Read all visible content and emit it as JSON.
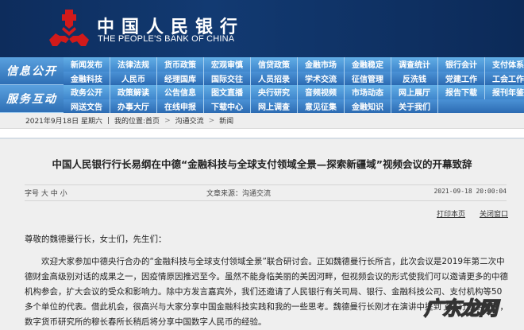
{
  "header": {
    "title_cn": "中国人民银行",
    "title_en": "THE PEOPLE'S BANK OF CHINA"
  },
  "nav": {
    "sections": [
      "信息公开",
      "服务互动"
    ],
    "rows": [
      [
        "新闻发布",
        "法律法规",
        "货币政策",
        "宏观审慎",
        "信贷政策",
        "金融市场",
        "金融稳定",
        "调查统计",
        "银行会计",
        "支付体系"
      ],
      [
        "金融科技",
        "人民币",
        "经理国库",
        "国际交往",
        "人员招录",
        "学术交流",
        "征信管理",
        "反洗钱",
        "党建工作",
        "工会工作"
      ],
      [
        "政务公开",
        "政策解读",
        "公告信息",
        "图文直播",
        "央行研究",
        "音频视频",
        "市场动态",
        "网上展厅",
        "报告下载",
        "报刊年鉴"
      ],
      [
        "网送文告",
        "办事大厅",
        "在线申报",
        "下载中心",
        "网上调查",
        "意见征集",
        "金融知识",
        "关于我们"
      ]
    ]
  },
  "breadcrumb": {
    "date": "2021年9月18日 星期六",
    "sep": "|",
    "label": "我的位置:",
    "items": [
      "首页",
      "沟通交流",
      "新闻"
    ],
    "arrow": ">"
  },
  "article": {
    "title": "中国人民银行行长易纲在中德“金融科技与全球支付领域全景—探索新疆域”视频会议的开幕致辞",
    "font_label": "字号",
    "font_sizes": [
      "大",
      "中",
      "小"
    ],
    "source": "文章来源：沟通交流",
    "datetime": "2021-09-18 20:00:04",
    "print": "打印本页",
    "close": "关闭窗口",
    "greeting": "尊敬的魏德曼行长，女士们，先生们：",
    "paragraph": "欢迎大家参加中德央行合办的“金融科技与全球支付领域全景”联合研讨会。正如魏德曼行长所言，此次会议是2019年第二次中德财金高级别对话的成果之一，因疫情原因推迟至今。虽然不能身临美丽的美因河畔，但视频会议的形式使我们可以邀请更多的中德机构参会，扩大会议的受众和影响力。除中方发言嘉宾外，我们还邀请了人民银行有关司局、银行、金融科技公司、支付机构等50多个单位的代表。借此机会，很高兴与大家分享中国金融科技实践和我的一些思考。魏德曼行长刚才在演讲中提到了央行数字货币，数字货币研究所的穆长春所长稍后将分享中国数字人民币的经验。"
  },
  "watermark": "广东龙网"
}
